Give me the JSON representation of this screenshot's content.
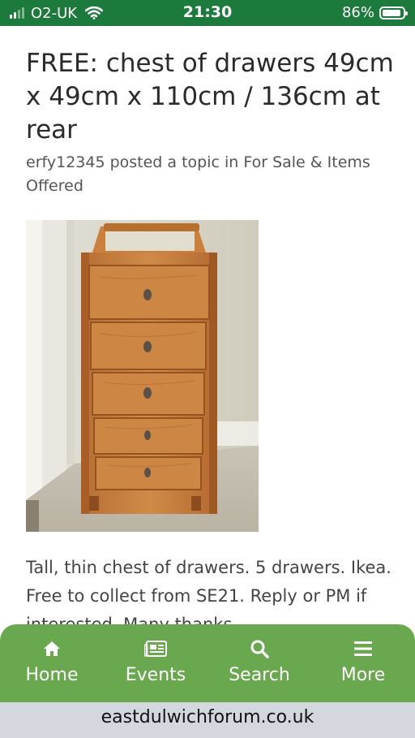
{
  "status_bar": {
    "carrier": "O2-UK",
    "time": "21:30",
    "battery": "86%"
  },
  "post": {
    "title": "FREE: chest of drawers 49cm x 49cm x 110cm / 136cm at rear",
    "meta": "erfy12345 posted a topic in For Sale & Items Offered",
    "body": "Tall, thin chest of drawers. 5 drawers. Ikea. Free to collect from SE21. Reply or PM if interested. Many thanks",
    "image_subject": "pine chest of drawers"
  },
  "tabbar": {
    "items": [
      {
        "label": "Home",
        "icon": "home-icon"
      },
      {
        "label": "Events",
        "icon": "newspaper-icon"
      },
      {
        "label": "Search",
        "icon": "search-icon"
      },
      {
        "label": "More",
        "icon": "menu-icon"
      }
    ]
  },
  "browser": {
    "url": "eastdulwichforum.co.uk"
  },
  "colors": {
    "status_bar": "#1c7a3c",
    "tabbar": "#6aa84f",
    "url_bar": "#d4d7de"
  }
}
